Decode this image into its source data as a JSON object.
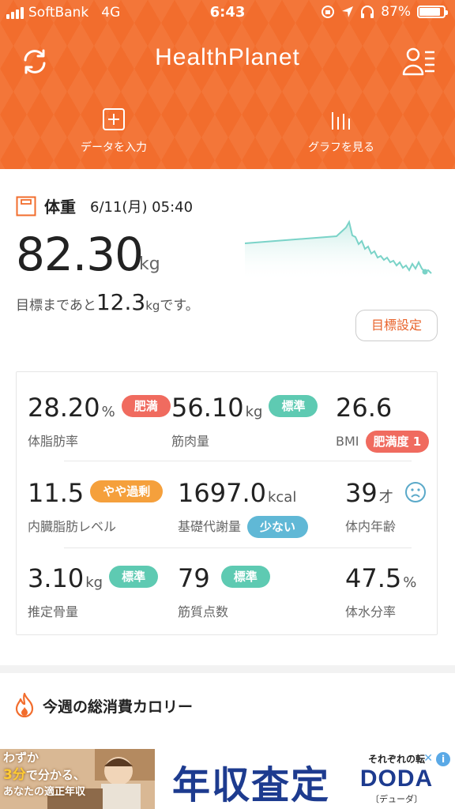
{
  "status_bar": {
    "carrier": "SoftBank",
    "network": "4G",
    "time": "6:43",
    "battery_percent": "87%",
    "battery_level": 0.87
  },
  "header": {
    "brand": "HealthPlanet",
    "actions": [
      {
        "label": "データを入力",
        "icon": "plus-square-icon"
      },
      {
        "label": "グラフを見る",
        "icon": "bar-chart-icon"
      }
    ],
    "left_icon": "sync-icon",
    "right_icon": "user-menu-icon"
  },
  "weight": {
    "label": "体重",
    "datetime": "6/11(月) 05:40",
    "value": "82.30",
    "unit": "kg",
    "goal_prefix": "目標まであと",
    "goal_value": "12.3",
    "goal_unit": "kg",
    "goal_suffix": "です。",
    "goal_button": "目標設定",
    "trend_color": "#7ad3c8"
  },
  "metrics": {
    "body_fat": {
      "value": "28.20",
      "unit": "%",
      "label": "体脂肪率",
      "badge": "肥満"
    },
    "muscle": {
      "value": "56.10",
      "unit": "kg",
      "label": "筋肉量",
      "badge": "標準"
    },
    "bmi": {
      "value": "26.6",
      "label": "BMI",
      "badge": "肥満度 1"
    },
    "visceral": {
      "value": "11.5",
      "label": "内臓脂肪レベル",
      "badge": "やや過剰"
    },
    "bmr": {
      "value": "1697.0",
      "unit": "kcal",
      "label": "基礎代謝量",
      "badge": "少ない"
    },
    "body_age": {
      "value": "39",
      "unit": "才",
      "label": "体内年齢",
      "icon": "sad-face-icon"
    },
    "bone": {
      "value": "3.10",
      "unit": "kg",
      "label": "推定骨量",
      "badge": "標準"
    },
    "muscle_quality": {
      "value": "79",
      "label": "筋質点数",
      "badge": "標準"
    },
    "water": {
      "value": "47.5",
      "unit": "%",
      "label": "体水分率"
    }
  },
  "weekly": {
    "title": "今週の総消費カロリー",
    "icon": "flame-icon"
  },
  "ad": {
    "left_line1": "わずか",
    "left_highlight": "3分",
    "left_line2": "で分かる、",
    "left_line3": "あなたの適正年収",
    "headline": "年収査定",
    "tagline": "それぞれの転",
    "brand": "DODA",
    "brand_sub": "〔デューダ〕",
    "info": "i",
    "close": "✕"
  },
  "colors": {
    "brand_orange": "#f26d2d",
    "badge_red": "#f06b5f",
    "badge_teal": "#5ecab2",
    "badge_orange": "#f5a03c",
    "badge_blue": "#60b8d6"
  }
}
